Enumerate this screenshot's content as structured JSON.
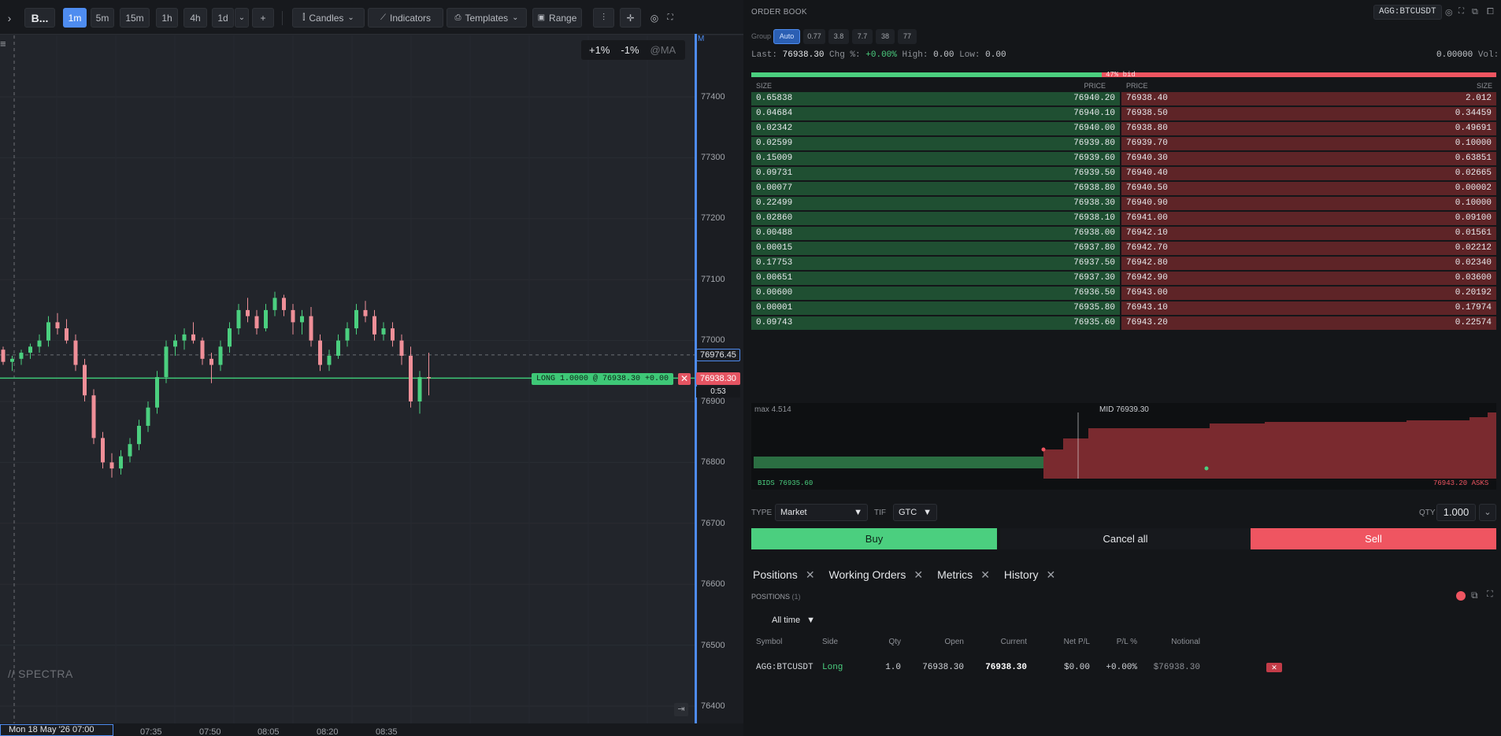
{
  "toolbar": {
    "symbol": "B...",
    "timeframes": [
      "1m",
      "5m",
      "15m",
      "1h",
      "4h",
      "1d"
    ],
    "active_timeframe": "1m",
    "add_label": "+",
    "chart_type": "Candles",
    "indicators": "Indicators",
    "templates": "Templates",
    "range": "Range"
  },
  "chart": {
    "pct_up": "+1%",
    "pct_down": "-1%",
    "ma_label": "@MA",
    "axis_marker": "M",
    "price_ticks": [
      "77400",
      "77300",
      "77200",
      "77100",
      "77000",
      "76900",
      "76800",
      "76700",
      "76600",
      "76500",
      "76400"
    ],
    "time_ticks": [
      "07:35",
      "07:50",
      "08:05",
      "08:20",
      "08:35"
    ],
    "date_label": "Mon 18 May '26 07:00",
    "last_price_tag": "76976.45",
    "position_price_tag": "76938.30",
    "countdown": "0:53",
    "long_label": "LONG 1.0000 @ 76938.30  +0.00",
    "close_glyph": "✕",
    "watermark": "SPECTRA",
    "candles": [
      [
        76985,
        76990,
        76960,
        76965
      ],
      [
        76965,
        76975,
        76950,
        76970
      ],
      [
        76970,
        76985,
        76960,
        76980
      ],
      [
        76980,
        76995,
        76970,
        76990
      ],
      [
        76990,
        77010,
        76980,
        77000
      ],
      [
        77000,
        77040,
        76990,
        77030
      ],
      [
        77030,
        77045,
        77010,
        77020
      ],
      [
        77020,
        77035,
        76995,
        77000
      ],
      [
        77000,
        77010,
        76950,
        76960
      ],
      [
        76960,
        76970,
        76900,
        76910
      ],
      [
        76910,
        76920,
        76830,
        76840
      ],
      [
        76840,
        76850,
        76790,
        76800
      ],
      [
        76800,
        76815,
        76775,
        76790
      ],
      [
        76790,
        76820,
        76780,
        76810
      ],
      [
        76810,
        76840,
        76800,
        76830
      ],
      [
        76830,
        76870,
        76820,
        76860
      ],
      [
        76860,
        76900,
        76850,
        76890
      ],
      [
        76890,
        76950,
        76880,
        76940
      ],
      [
        76940,
        77000,
        76930,
        76990
      ],
      [
        76990,
        77010,
        76975,
        77000
      ],
      [
        77000,
        77020,
        76985,
        77010
      ],
      [
        77010,
        77030,
        76995,
        77000
      ],
      [
        77000,
        77005,
        76960,
        76970
      ],
      [
        76970,
        76980,
        76930,
        76960
      ],
      [
        76960,
        77000,
        76950,
        76990
      ],
      [
        76990,
        77030,
        76980,
        77020
      ],
      [
        77020,
        77060,
        77010,
        77050
      ],
      [
        77050,
        77070,
        77030,
        77040
      ],
      [
        77040,
        77050,
        77010,
        77020
      ],
      [
        77020,
        77060,
        77015,
        77050
      ],
      [
        77050,
        77080,
        77040,
        77070
      ],
      [
        77070,
        77075,
        77040,
        77050
      ],
      [
        77050,
        77060,
        77010,
        77030
      ],
      [
        77030,
        77050,
        77010,
        77040
      ],
      [
        77040,
        77055,
        76990,
        77000
      ],
      [
        77000,
        77010,
        76950,
        76960
      ],
      [
        76960,
        76985,
        76950,
        76975
      ],
      [
        76975,
        77010,
        76970,
        77000
      ],
      [
        77000,
        77030,
        76990,
        77020
      ],
      [
        77020,
        77060,
        77010,
        77050
      ],
      [
        77050,
        77065,
        77030,
        77040
      ],
      [
        77040,
        77050,
        77000,
        77010
      ],
      [
        77010,
        77030,
        77000,
        77020
      ],
      [
        77020,
        77030,
        76990,
        77000
      ],
      [
        77000,
        77010,
        76960,
        76975
      ],
      [
        76975,
        76990,
        76890,
        76900
      ],
      [
        76900,
        76950,
        76880,
        76940
      ],
      [
        76940,
        76980,
        76910,
        76938
      ]
    ]
  },
  "order_book": {
    "title": "ORDER BOOK",
    "symbol": "AGG:BTCUSDT",
    "group_label": "Group",
    "group_options": [
      "Auto",
      "0.77",
      "3.8",
      "7.7",
      "38",
      "77"
    ],
    "group_selected": "Auto",
    "last_label": "Last:",
    "last_value": "76938.30",
    "chg_label": "Chg %:",
    "chg_value": "+0.00%",
    "high_label": "High:",
    "high_value": "0.00",
    "low_label": "Low:",
    "low_value": "0.00",
    "vol_value": "0.00000",
    "vol_label": "Vol:",
    "imbalance_label": "47% bid",
    "imbalance_bid_fraction": 0.47,
    "headers": {
      "bid_size": "SIZE",
      "bid_price": "PRICE",
      "ask_price": "PRICE",
      "ask_size": "SIZE"
    },
    "bids": [
      [
        "0.65838",
        "76940.20"
      ],
      [
        "0.04684",
        "76940.10"
      ],
      [
        "0.02342",
        "76940.00"
      ],
      [
        "0.02599",
        "76939.80"
      ],
      [
        "0.15009",
        "76939.60"
      ],
      [
        "0.09731",
        "76939.50"
      ],
      [
        "0.00077",
        "76938.80"
      ],
      [
        "0.22499",
        "76938.30"
      ],
      [
        "0.02860",
        "76938.10"
      ],
      [
        "0.00488",
        "76938.00"
      ],
      [
        "0.00015",
        "76937.80"
      ],
      [
        "0.17753",
        "76937.50"
      ],
      [
        "0.00651",
        "76937.30"
      ],
      [
        "0.00600",
        "76936.50"
      ],
      [
        "0.00001",
        "76935.80"
      ],
      [
        "0.09743",
        "76935.60"
      ]
    ],
    "asks": [
      [
        "76938.40",
        "2.012"
      ],
      [
        "76938.50",
        "0.34459"
      ],
      [
        "76938.80",
        "0.49691"
      ],
      [
        "76939.70",
        "0.10000"
      ],
      [
        "76940.30",
        "0.63851"
      ],
      [
        "76940.40",
        "0.02665"
      ],
      [
        "76940.50",
        "0.00002"
      ],
      [
        "76940.90",
        "0.10000"
      ],
      [
        "76941.00",
        "0.09100"
      ],
      [
        "76942.10",
        "0.01561"
      ],
      [
        "76942.70",
        "0.02212"
      ],
      [
        "76942.80",
        "0.02340"
      ],
      [
        "76942.90",
        "0.03600"
      ],
      [
        "76943.00",
        "0.20192"
      ],
      [
        "76943.10",
        "0.17974"
      ],
      [
        "76943.20",
        "0.22574"
      ]
    ]
  },
  "depth": {
    "max_label": "max 4.514",
    "mid_label": "MID 76939.30",
    "bids_label": "BIDS",
    "bids_price": "76935.60",
    "asks_price": "76943.20",
    "asks_label": "ASKS"
  },
  "order_entry": {
    "type_label": "TYPE",
    "type_value": "Market",
    "tif_label": "TIF",
    "tif_value": "GTC",
    "qty_label": "QTY",
    "qty_value": "1.000",
    "buy_label": "Buy",
    "cancel_label": "Cancel all",
    "sell_label": "Sell",
    "colors": {
      "buy": "#4bcf7f",
      "sell": "#ef5561"
    }
  },
  "panel_tabs": [
    "Positions",
    "Working Orders",
    "Metrics",
    "History"
  ],
  "positions": {
    "title": "POSITIONS",
    "count": "(1)",
    "filter": "All time",
    "columns": [
      "Symbol",
      "Side",
      "Qty",
      "Open",
      "Current",
      "Net P/L",
      "P/L %",
      "Notional"
    ],
    "rows": [
      [
        "AGG:BTCUSDT",
        "Long",
        "1.0",
        "76938.30",
        "76938.30",
        "$0.00",
        "+0.00%",
        "$76938.30"
      ]
    ]
  }
}
